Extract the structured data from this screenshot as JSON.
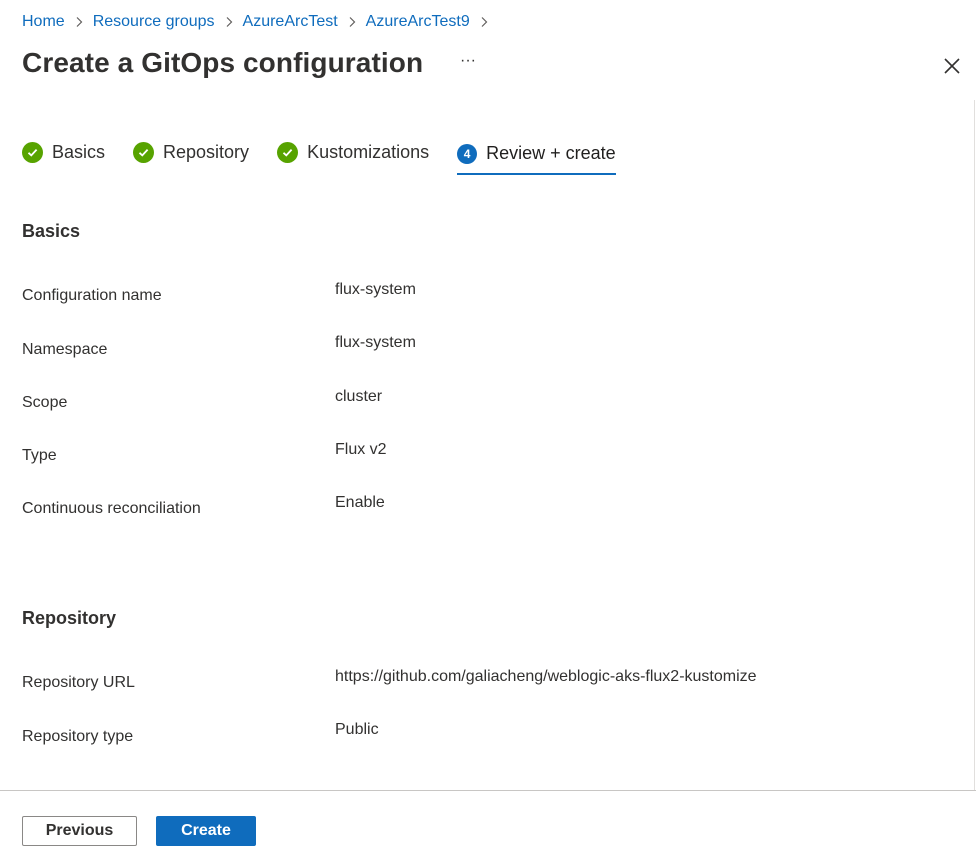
{
  "breadcrumb": [
    "Home",
    "Resource groups",
    "AzureArcTest",
    "AzureArcTest9"
  ],
  "header": {
    "title": "Create a GitOps configuration",
    "more_label": "···"
  },
  "tabs": [
    {
      "label": "Basics",
      "state": "complete"
    },
    {
      "label": "Repository",
      "state": "complete"
    },
    {
      "label": "Kustomizations",
      "state": "complete"
    },
    {
      "label": "Review + create",
      "state": "active",
      "step": "4"
    }
  ],
  "basics": {
    "heading": "Basics",
    "rows": [
      {
        "label": "Configuration name",
        "value": "flux-system"
      },
      {
        "label": "Namespace",
        "value": "flux-system"
      },
      {
        "label": "Scope",
        "value": "cluster"
      },
      {
        "label": "Type",
        "value": "Flux v2"
      },
      {
        "label": "Continuous reconciliation",
        "value": "Enable"
      }
    ]
  },
  "repository": {
    "heading": "Repository",
    "rows": [
      {
        "label": "Repository URL",
        "value": "https://github.com/galiacheng/weblogic-aks-flux2-kustomize"
      },
      {
        "label": "Repository type",
        "value": "Public"
      }
    ]
  },
  "footer": {
    "previous_label": "Previous",
    "create_label": "Create"
  },
  "colors": {
    "accent": "#0f6cbd",
    "success": "#57a300",
    "text": "#323130"
  }
}
